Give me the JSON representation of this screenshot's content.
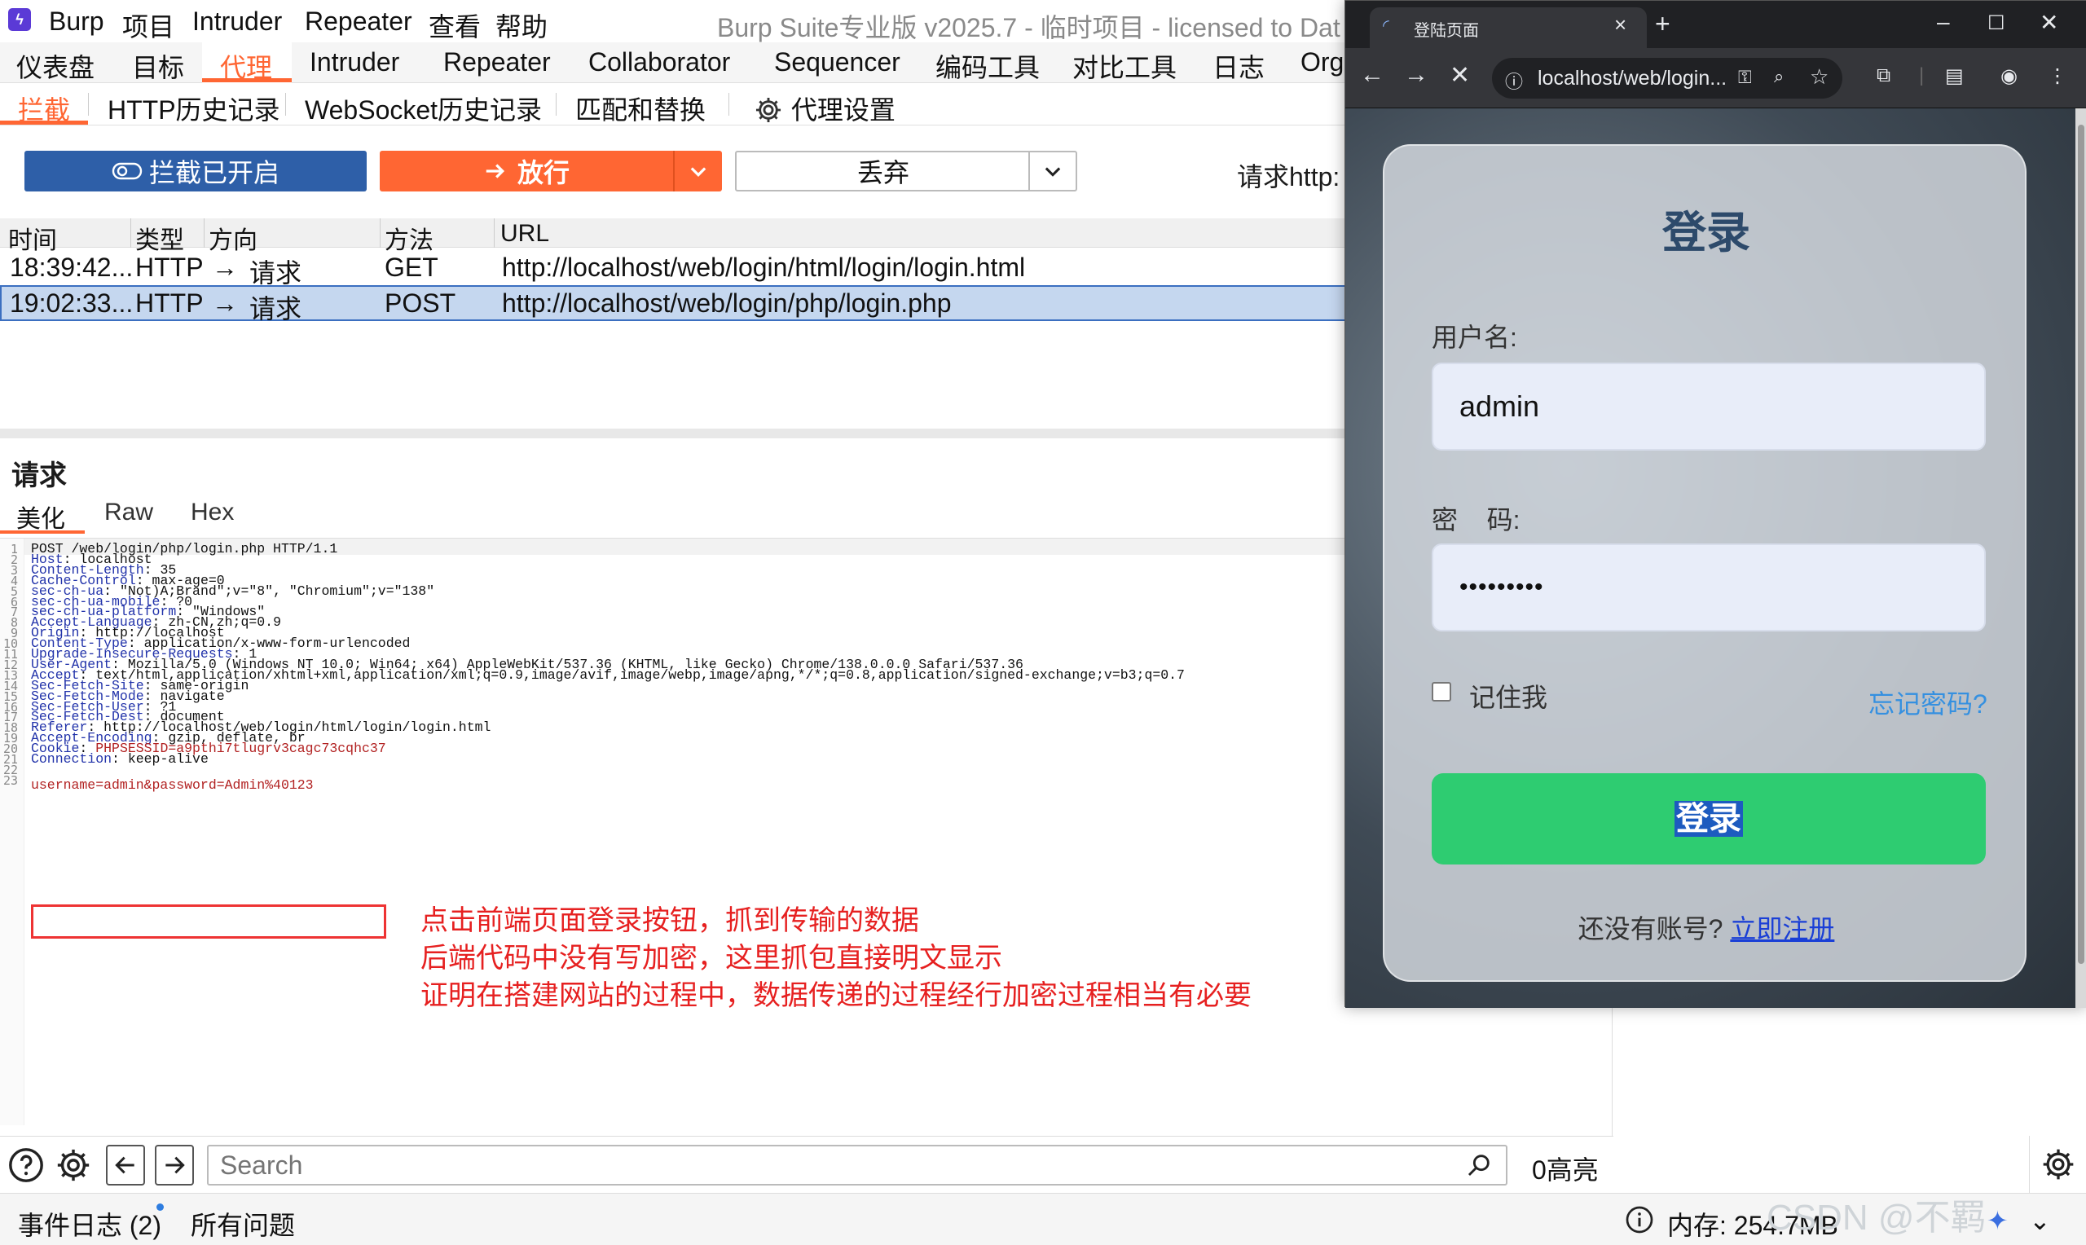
{
  "burp": {
    "menu": [
      "Burp",
      "项目",
      "Intruder",
      "Repeater",
      "查看",
      "帮助"
    ],
    "window_title": "Burp Suite专业版  v2025.7 - 临时项目 - licensed to Dat",
    "top_tabs": [
      "仪表盘",
      "目标",
      "代理",
      "Intruder",
      "Repeater",
      "Collaborator",
      "Sequencer",
      "编码工具",
      "对比工具",
      "日志",
      "Org"
    ],
    "proxy_tabs": [
      "拦截",
      "HTTP历史记录",
      "WebSocket历史记录",
      "匹配和替换",
      "代理设置"
    ],
    "toolbar": {
      "intercept_label": "拦截已开启",
      "forward_label": "放行",
      "drop_label": "丢弃",
      "request_info": "请求http:"
    },
    "table": {
      "headers": [
        "时间",
        "类型",
        "方向",
        "方法",
        "URL"
      ],
      "rows": [
        {
          "time": "18:39:42...",
          "type": "HTTP",
          "dir": "请求",
          "method": "GET",
          "url": "http://localhost/web/login/html/login/login.html"
        },
        {
          "time": "19:02:33...",
          "type": "HTTP",
          "dir": "请求",
          "method": "POST",
          "url": "http://localhost/web/login/php/login.php"
        }
      ]
    },
    "request": {
      "title": "请求",
      "subtabs": [
        "美化",
        "Raw",
        "Hex"
      ],
      "request_line": "POST /web/login/php/login.php HTTP/1.1",
      "headers": [
        {
          "k": "Host",
          "v": "localhost"
        },
        {
          "k": "Content-Length",
          "v": "35"
        },
        {
          "k": "Cache-Control",
          "v": "max-age=0"
        },
        {
          "k": "sec-ch-ua",
          "v": "\"Not)A;Brand\";v=\"8\", \"Chromium\";v=\"138\""
        },
        {
          "k": "sec-ch-ua-mobile",
          "v": "?0"
        },
        {
          "k": "sec-ch-ua-platform",
          "v": "\"Windows\""
        },
        {
          "k": "Accept-Language",
          "v": "zh-CN,zh;q=0.9"
        },
        {
          "k": "Origin",
          "v": "http://localhost"
        },
        {
          "k": "Content-Type",
          "v": "application/x-www-form-urlencoded"
        },
        {
          "k": "Upgrade-Insecure-Requests",
          "v": "1"
        },
        {
          "k": "User-Agent",
          "v": "Mozilla/5.0 (Windows NT 10.0; Win64; x64) AppleWebKit/537.36 (KHTML, like Gecko) Chrome/138.0.0.0 Safari/537.36"
        },
        {
          "k": "Accept",
          "v": "text/html,application/xhtml+xml,application/xml;q=0.9,image/avif,image/webp,image/apng,*/*;q=0.8,application/signed-exchange;v=b3;q=0.7"
        },
        {
          "k": "Sec-Fetch-Site",
          "v": "same-origin"
        },
        {
          "k": "Sec-Fetch-Mode",
          "v": "navigate"
        },
        {
          "k": "Sec-Fetch-User",
          "v": "?1"
        },
        {
          "k": "Sec-Fetch-Dest",
          "v": "document"
        },
        {
          "k": "Referer",
          "v": "http://localhost/web/login/html/login/login.html"
        },
        {
          "k": "Accept-Encoding",
          "v": "gzip, deflate, br"
        },
        {
          "k": "Cookie",
          "v": "PHPSESSID=a9pthi7tlugrv3cagc73cqhc37",
          "cookie": true
        },
        {
          "k": "Connection",
          "v": "keep-alive"
        }
      ],
      "body": "username=admin&password=Admin%40123"
    },
    "annotation": [
      "点击前端页面登录按钮，抓到传输的数据",
      "后端代码中没有写加密，这里抓包直接明文显示",
      "证明在搭建网站的过程中，数据传递的过程经行加密过程相当有必要"
    ],
    "search": {
      "placeholder": "Search",
      "highlights": "0高亮"
    },
    "status": {
      "event_log": "事件日志 (2)",
      "all_issues": "所有问题",
      "memory": "内存: 254.7MB"
    }
  },
  "browser": {
    "tab_title": "登陆页面",
    "url": "localhost/web/login...",
    "login": {
      "title": "登录",
      "username_label": "用户名:",
      "username_value": "admin",
      "password_label": "密    码:",
      "password_mask": "•••••••••",
      "remember_label": "记住我",
      "forgot_label": "忘记密码?",
      "button_label": "登录",
      "register_prompt": "还没有账号?",
      "register_link": "立即注册"
    }
  },
  "watermark": "CSDN @不羁",
  "colors": {
    "accent": "#ff6633",
    "intercept_blue": "#2e5fa8",
    "login_green": "#2ecc71",
    "annotation_red": "#e62020"
  }
}
